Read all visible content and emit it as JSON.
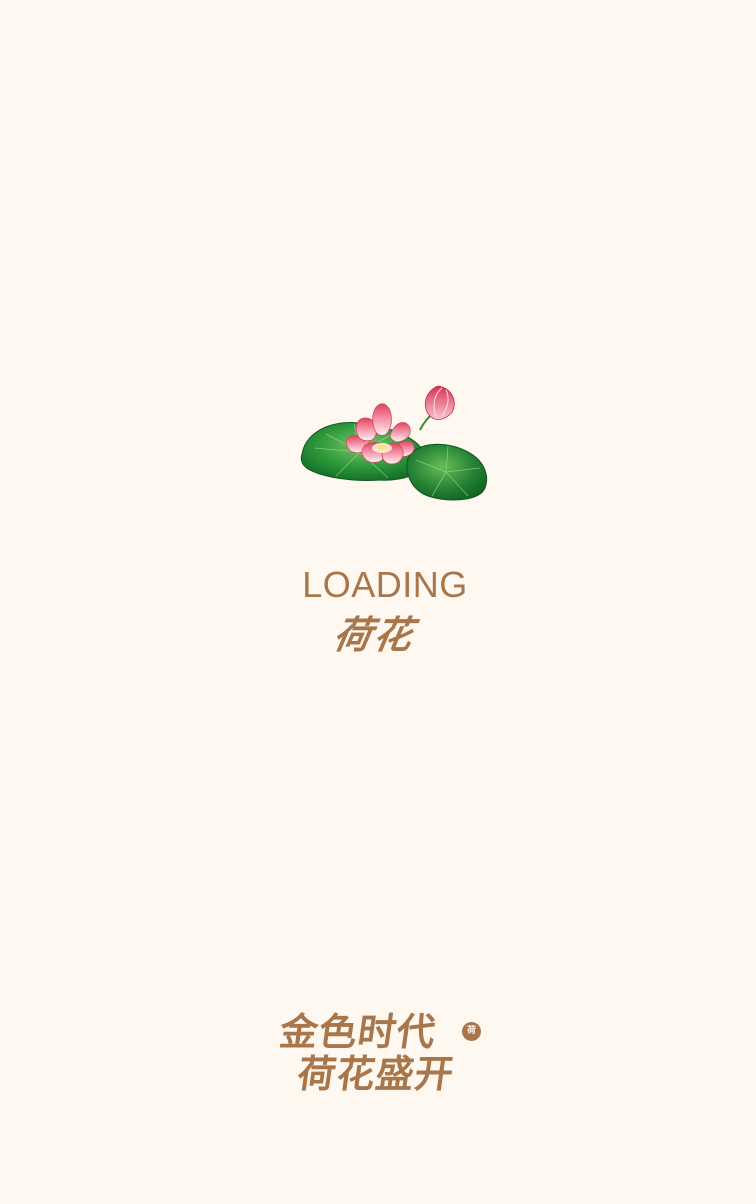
{
  "splash": {
    "loading_label": "LOADING",
    "loading_subtitle": "荷花",
    "slogan_line_1": "金色时代",
    "slogan_line_2": "荷花盛开",
    "seal_text": "荷"
  },
  "icons": {
    "illustration": "lotus-flower-icon",
    "seal": "red-seal-stamp-icon"
  },
  "colors": {
    "background": "#fef8f1",
    "text_brown": "#a8764a",
    "lotus_pink": "#ef6f87",
    "leaf_green": "#2e8b3a"
  }
}
